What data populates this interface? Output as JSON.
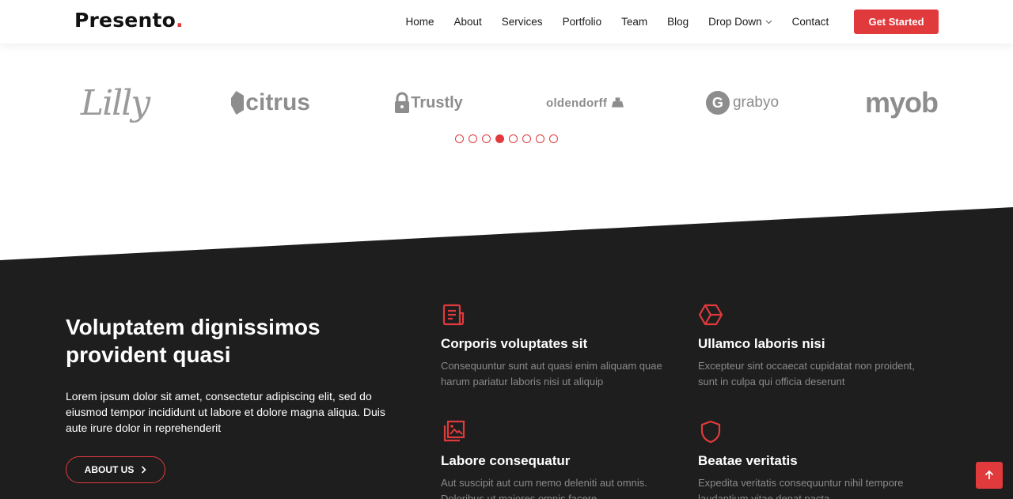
{
  "header": {
    "logo_text": "Presento",
    "logo_dot": ".",
    "nav": [
      {
        "label": "Home"
      },
      {
        "label": "About"
      },
      {
        "label": "Services"
      },
      {
        "label": "Portfolio"
      },
      {
        "label": "Team"
      },
      {
        "label": "Blog"
      },
      {
        "label": "Drop Down"
      },
      {
        "label": "Contact"
      }
    ],
    "cta_label": "Get Started"
  },
  "clients": {
    "logos": [
      "Lilly",
      "citrus",
      "Trustly",
      "oldendorff",
      "grabyo",
      "myob"
    ],
    "carousel_pages": 8,
    "carousel_active_index": 3
  },
  "about": {
    "title": "Voluptatem dignissimos provident quasi",
    "text": "Lorem ipsum dolor sit amet, consectetur adipiscing elit, sed do eiusmod tempor incididunt ut labore et dolore magna aliqua. Duis aute irure dolor in reprehenderit",
    "button_label": "ABOUT US",
    "features": [
      {
        "icon": "receipt-icon",
        "title": "Corporis voluptates sit",
        "desc": "Consequuntur sunt aut quasi enim aliquam quae harum pariatur laboris nisi ut aliquip"
      },
      {
        "icon": "cube-icon",
        "title": "Ullamco laboris nisi",
        "desc": "Excepteur sint occaecat cupidatat non proident, sunt in culpa qui officia deserunt"
      },
      {
        "icon": "images-icon",
        "title": "Labore consequatur",
        "desc": "Aut suscipit aut cum nemo deleniti aut omnis. Doloribus ut maiores omnis facere"
      },
      {
        "icon": "shield-icon",
        "title": "Beatae veritatis",
        "desc": "Expedita veritatis consequuntur nihil tempore laudantium vitae denat pacta"
      }
    ]
  },
  "colors": {
    "accent": "#e03a3c",
    "dark_bg": "#1e1e1e"
  }
}
